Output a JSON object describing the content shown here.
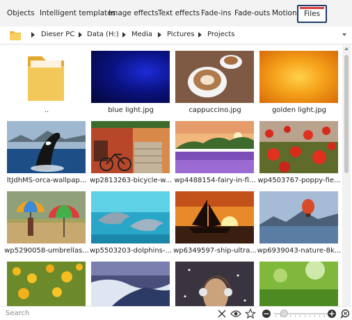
{
  "tabs": [
    {
      "label": "Objects"
    },
    {
      "label": "Intelligent templates"
    },
    {
      "label": "Image effects"
    },
    {
      "label": "Text effects"
    },
    {
      "label": "Fade-ins"
    },
    {
      "label": "Fade-outs"
    },
    {
      "label": "Motions"
    },
    {
      "label": "Files",
      "active": true
    }
  ],
  "breadcrumb": [
    "Dieser PC",
    "Data (H:)",
    "Media",
    "Pictures",
    "Projects"
  ],
  "items": [
    {
      "name": "..",
      "icon": "folder-icon"
    },
    {
      "name": "blue light.jpg"
    },
    {
      "name": "cappuccino.jpg"
    },
    {
      "name": "golden light.jpg"
    },
    {
      "name": "ltJdhMS-orca-wallpap..."
    },
    {
      "name": "wp2813263-bicycle-w..."
    },
    {
      "name": "wp4488154-fairy-in-fl..."
    },
    {
      "name": "wp4503767-poppy-fie..."
    },
    {
      "name": "wp5290058-umbrellas..."
    },
    {
      "name": "wp5503203-dolphins-..."
    },
    {
      "name": "wp6349597-ship-ultra..."
    },
    {
      "name": "wp6939043-nature-8k..."
    },
    {
      "name": ""
    },
    {
      "name": ""
    },
    {
      "name": ""
    },
    {
      "name": ""
    }
  ],
  "search": {
    "placeholder": "Search"
  },
  "zoom": {
    "level": 0.18
  },
  "colors": {
    "active_tab_border": "#1c3c66",
    "active_tab_accent": "#e03a3a"
  }
}
